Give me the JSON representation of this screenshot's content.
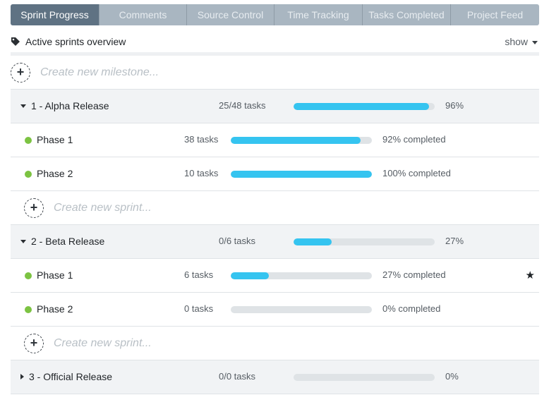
{
  "tabs": [
    {
      "label": "Sprint Progress",
      "active": true
    },
    {
      "label": "Comments",
      "active": false
    },
    {
      "label": "Source Control",
      "active": false
    },
    {
      "label": "Time Tracking",
      "active": false
    },
    {
      "label": "Tasks Completed",
      "active": false
    },
    {
      "label": "Project Feed",
      "active": false
    }
  ],
  "header": {
    "title": "Active sprints overview",
    "show_label": "show",
    "icon": "tag-icon"
  },
  "create_milestone": {
    "text": "Create new milestone..."
  },
  "releases": [
    {
      "name": "1 - Alpha Release",
      "tasks": "25/48 tasks",
      "progress": 0.96,
      "percent": "96%",
      "expanded": true,
      "phases": [
        {
          "name": "Phase 1",
          "tasks": "38 tasks",
          "progress": 0.92,
          "percent": "92% completed",
          "starred": false
        },
        {
          "name": "Phase 2",
          "tasks": "10 tasks",
          "progress": 1.0,
          "percent": "100% completed",
          "starred": false
        }
      ],
      "create_sprint": "Create new sprint..."
    },
    {
      "name": "2 - Beta Release",
      "tasks": "0/6 tasks",
      "progress": 0.27,
      "percent": "27%",
      "expanded": true,
      "phases": [
        {
          "name": "Phase 1",
          "tasks": "6 tasks",
          "progress": 0.27,
          "percent": "27% completed",
          "starred": true
        },
        {
          "name": "Phase 2",
          "tasks": "0 tasks",
          "progress": 0.0,
          "percent": "0% completed",
          "starred": false
        }
      ],
      "create_sprint": "Create new sprint..."
    },
    {
      "name": "3 - Official Release",
      "tasks": "0/0 tasks",
      "progress": 0.0,
      "percent": "0%",
      "expanded": false,
      "phases": [],
      "create_sprint": ""
    }
  ],
  "colors": {
    "accent": "#35c4f0",
    "phase_dot": "#7cc342",
    "tab_active": "#5f7283",
    "tab_inactive": "#a9b6c1"
  },
  "icons": {
    "star": "star-icon",
    "plus": "plus-icon",
    "caret_down": "caret-down-icon",
    "caret_right": "caret-right-icon"
  }
}
